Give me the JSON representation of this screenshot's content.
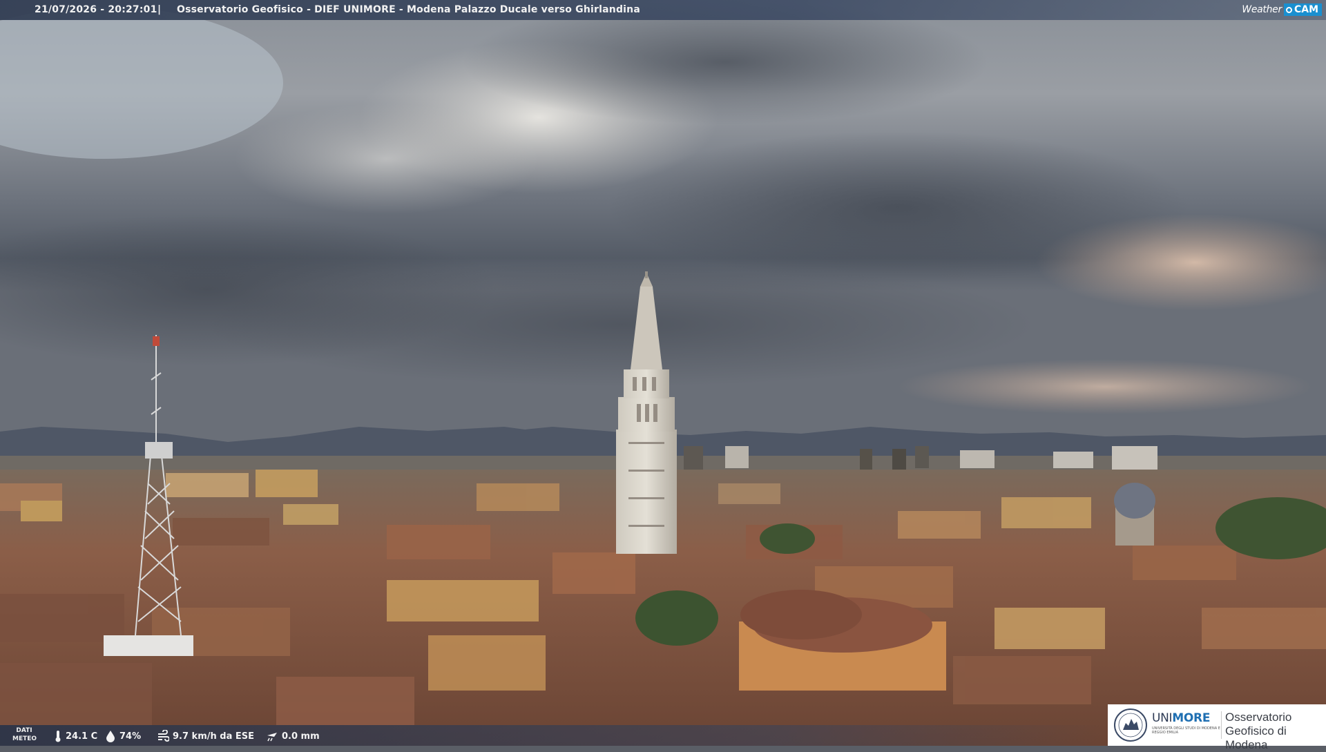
{
  "header": {
    "timestamp": "21/07/2026 - 20:27:01",
    "separator": "|",
    "title": "Osservatorio Geofisico - DIEF UNIMORE - Modena Palazzo Ducale verso Ghirlandina"
  },
  "brand": {
    "weather": "Weather",
    "cam": "CAM"
  },
  "weather_bar": {
    "label_line1": "DATI",
    "label_line2": "METEO",
    "temperature": "24.1 C",
    "humidity": "74%",
    "wind": "9.7 km/h da ESE",
    "rain": "0.0 mm"
  },
  "logo": {
    "university_prefix": "UNI",
    "university_suffix": "MORE",
    "university_sub": "Università degli studi di Modena e Reggio Emilia",
    "observatory": "Osservatorio Geofisico di Modena"
  },
  "colors": {
    "banner": "#303c52",
    "brand_blue": "#1a8fd0",
    "unimore_blue": "#1f6fb2",
    "roof_terracotta": "#8a5a44",
    "sky_cloud": "#6c727c"
  },
  "icons": {
    "temperature": "thermometer-icon",
    "humidity": "droplet-icon",
    "wind": "wind-icon",
    "rain": "rain-gauge-icon"
  }
}
